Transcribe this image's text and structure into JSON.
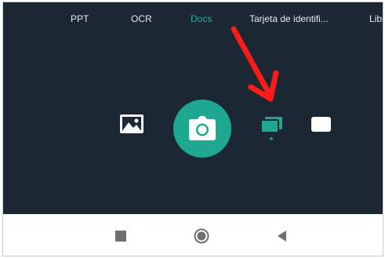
{
  "mode_tabs": {
    "ppt": "PPT",
    "ocr": "OCR",
    "docs": "Docs",
    "tarjeta": "Tarjeta de identifi...",
    "libro": "Libro",
    "active": "Docs"
  },
  "colors": {
    "background": "#1b2733",
    "accent": "#1ea891",
    "arrow": "#ff1a1a",
    "nav_bar": "#ffffff"
  },
  "tools": {
    "gallery": "image-icon",
    "shutter": "camera-icon",
    "multipage": "multi-page-icon",
    "single": "single-page-icon"
  },
  "nav": {
    "recents": "square-icon",
    "home": "circle-icon",
    "back": "triangle-back-icon"
  }
}
